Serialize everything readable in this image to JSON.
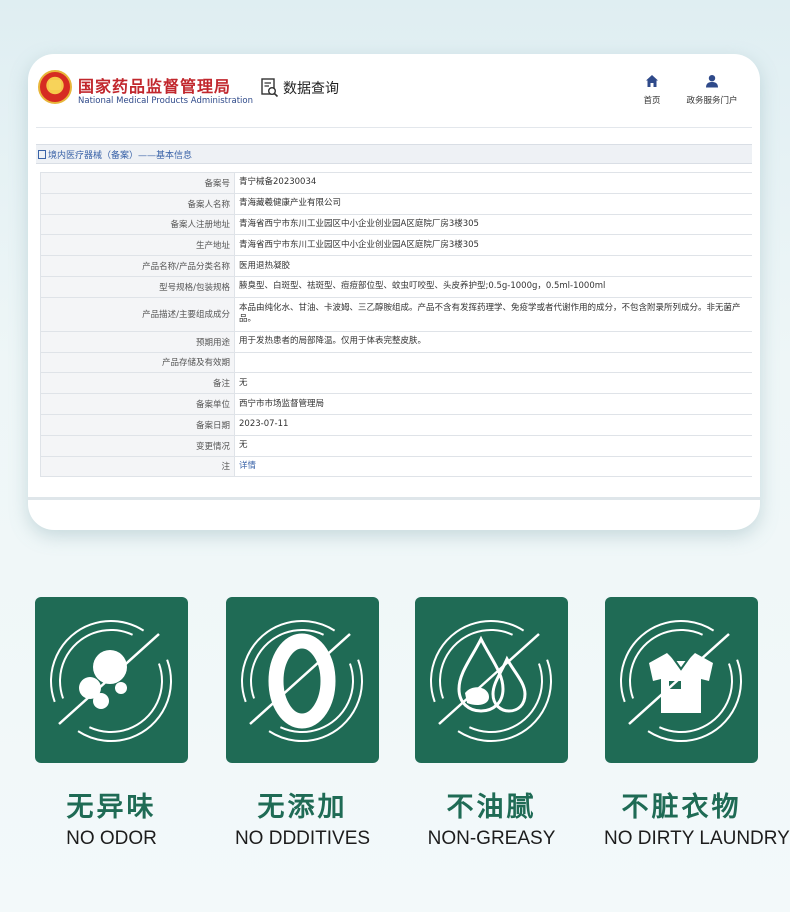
{
  "site": {
    "name_cn": "国家药品监督管理局",
    "name_en": "National Medical Products Administration",
    "query_label": "数据查询",
    "nav": [
      {
        "label": "首页",
        "icon": "home-icon"
      },
      {
        "label": "政务服务门户",
        "icon": "user-icon"
      }
    ]
  },
  "breadcrumb": "境内医疗器械（备案）——基本信息",
  "record": {
    "rows": [
      {
        "key": "备案号",
        "value": "青宁械备20230034"
      },
      {
        "key": "备案人名称",
        "value": "青海藏羲健康产业有限公司"
      },
      {
        "key": "备案人注册地址",
        "value": "青海省西宁市东川工业园区中小企业创业园A区庭院厂房3楼305"
      },
      {
        "key": "生产地址",
        "value": "青海省西宁市东川工业园区中小企业创业园A区庭院厂房3楼305"
      },
      {
        "key": "产品名称/产品分类名称",
        "value": "医用退热凝胶"
      },
      {
        "key": "型号规格/包装规格",
        "value": "腋臭型、白斑型、祛斑型、痘痘部位型、蚊虫叮咬型、头皮养护型;0.5g-1000g，0.5ml-1000ml"
      },
      {
        "key": "产品描述/主要组成成分",
        "value": "本品由纯化水、甘油、卡波姆、三乙醇胺组成。产品不含有发挥药理学、免疫学或者代谢作用的成分，不包含附录所列成分。非无菌产品。"
      },
      {
        "key": "预期用途",
        "value": "用于发热患者的局部降温。仅用于体表完整皮肤。"
      },
      {
        "key": "产品存储及有效期",
        "value": ""
      },
      {
        "key": "备注",
        "value": "无"
      },
      {
        "key": "备案单位",
        "value": "西宁市市场监督管理局"
      },
      {
        "key": "备案日期",
        "value": "2023-07-11"
      },
      {
        "key": "变更情况",
        "value": "无"
      },
      {
        "key": "注",
        "value": "详情"
      }
    ]
  },
  "features": [
    {
      "cn": "无异味",
      "en": "NO ODOR",
      "icon": "no-odor-icon"
    },
    {
      "cn": "无添加",
      "en": "NO DDDITIVES",
      "icon": "zero-additives-icon"
    },
    {
      "cn": "不油腻",
      "en": "NON-GREASY",
      "icon": "no-grease-icon"
    },
    {
      "cn": "不脏衣物",
      "en": "NO DIRTY LAUNDRY",
      "icon": "no-dirty-laundry-icon"
    }
  ],
  "colors": {
    "brand_red": "#c1272d",
    "tile_green": "#1f6b55",
    "link_blue": "#3a63a8"
  }
}
